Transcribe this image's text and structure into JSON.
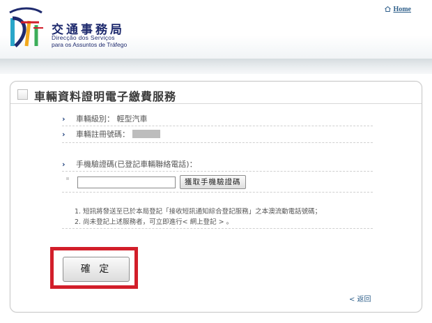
{
  "header": {
    "logo_cn": "交通事務局",
    "logo_pt_line1": "Direcção dos Serviços",
    "logo_pt_line2": "para os Assuntos de Tráfego",
    "home_label": "Home"
  },
  "panel": {
    "title": "車輛資料證明電子繳費服務",
    "vehicle_class": "車輛級別： 輕型汽車",
    "plate_label": "車輛註冊號碼：",
    "phone_label": "手機驗證碼(已登記車輛聯絡電話)：",
    "get_code_button": "獲取手機驗證碼",
    "note1": "1. 短訊將發送至已於本局登記「接收短訊通知綜合登記服務」之本澳流動電話號碼；",
    "note2": "2. 尚未登記上述服務者，可立即進行< 網上登記 > 。",
    "confirm_button": "確 定",
    "back_link": "< 返回"
  },
  "colors": {
    "brand_navy": "#1e2a6e",
    "highlight_red": "#d21e2a",
    "link_blue": "#2e5f8a"
  }
}
